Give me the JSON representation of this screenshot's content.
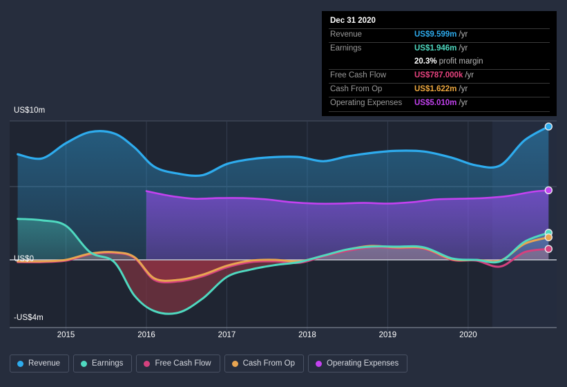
{
  "chart_data": {
    "type": "area",
    "title": "",
    "xlabel": "",
    "ylabel": "",
    "grid": true,
    "legend_position": "bottom",
    "x_ticks": [
      "2015",
      "2016",
      "2017",
      "2018",
      "2019",
      "2020"
    ],
    "y_ticks": [
      "US$10m",
      "US$0",
      "-US$4m"
    ],
    "ylim": [
      -4,
      10
    ],
    "xlim": [
      2014.3,
      2021.1
    ],
    "gridlines_y": [
      10,
      5,
      0
    ],
    "colors": {
      "revenue": "#2eacee",
      "earnings": "#4fd9c0",
      "free_cash_flow": "#d4417e",
      "cash_from_op": "#e8a551",
      "operating_expenses": "#c342f0",
      "background": "#262d3d",
      "plot_background": "#1f2532",
      "axis_line": "#9aa1ae",
      "gridline": "#3d4556",
      "tooltip_background": "#000000"
    },
    "series": [
      {
        "name": "Revenue",
        "color": "#2eacee",
        "x": [
          2014.4,
          2014.7,
          2015.0,
          2015.3,
          2015.6,
          2015.85,
          2016.1,
          2016.4,
          2016.7,
          2017.0,
          2017.3,
          2017.6,
          2017.9,
          2018.2,
          2018.5,
          2018.8,
          2019.1,
          2019.45,
          2019.8,
          2020.1,
          2020.4,
          2020.7,
          2021.0
        ],
        "values": [
          7.6,
          7.3,
          8.4,
          9.2,
          9.1,
          8.1,
          6.7,
          6.2,
          6.1,
          6.9,
          7.25,
          7.4,
          7.4,
          7.1,
          7.45,
          7.7,
          7.85,
          7.8,
          7.35,
          6.8,
          6.8,
          8.6,
          9.599
        ]
      },
      {
        "name": "Earnings",
        "color": "#4fd9c0",
        "x": [
          2014.4,
          2014.7,
          2015.0,
          2015.3,
          2015.6,
          2015.85,
          2016.1,
          2016.4,
          2016.7,
          2017.0,
          2017.3,
          2017.6,
          2017.9,
          2018.2,
          2018.5,
          2018.8,
          2019.1,
          2019.45,
          2019.8,
          2020.1,
          2020.4,
          2020.7,
          2021.0
        ],
        "values": [
          2.95,
          2.85,
          2.45,
          0.55,
          -0.15,
          -2.4,
          -3.45,
          -3.55,
          -2.6,
          -1.15,
          -0.65,
          -0.35,
          -0.15,
          0.3,
          0.75,
          0.95,
          0.95,
          0.9,
          0.1,
          0.0,
          -0.1,
          1.3,
          1.946
        ]
      },
      {
        "name": "Free Cash Flow",
        "color": "#d4417e",
        "x": [
          2014.4,
          2014.7,
          2015.0,
          2015.3,
          2015.6,
          2015.85,
          2016.1,
          2016.4,
          2016.7,
          2017.0,
          2017.3,
          2017.6,
          2017.9,
          2018.2,
          2018.5,
          2018.8,
          2019.1,
          2019.45,
          2019.8,
          2020.1,
          2020.4,
          2020.7,
          2021.0
        ],
        "values": [
          -0.15,
          -0.15,
          -0.05,
          0.4,
          0.5,
          0.15,
          -1.35,
          -1.45,
          -1.1,
          -0.5,
          -0.15,
          -0.1,
          -0.2,
          0.25,
          0.65,
          0.9,
          0.85,
          0.8,
          0.0,
          -0.05,
          -0.45,
          0.55,
          0.787
        ]
      },
      {
        "name": "Cash From Op",
        "color": "#e8a551",
        "x": [
          2014.4,
          2014.7,
          2015.0,
          2015.3,
          2015.6,
          2015.85,
          2016.1,
          2016.4,
          2016.7,
          2017.0,
          2017.3,
          2017.6,
          2017.9,
          2018.2,
          2018.5,
          2018.8,
          2019.1,
          2019.45,
          2019.8,
          2020.1,
          2020.4,
          2020.7,
          2021.0
        ],
        "values": [
          -0.1,
          -0.1,
          0.0,
          0.45,
          0.55,
          0.2,
          -1.25,
          -1.35,
          -1.0,
          -0.4,
          -0.05,
          0.0,
          -0.1,
          0.3,
          0.75,
          1.0,
          0.9,
          0.85,
          0.05,
          0.0,
          -0.05,
          1.15,
          1.622
        ]
      },
      {
        "name": "Operating Expenses",
        "color": "#c342f0",
        "x": [
          2016.0,
          2016.3,
          2016.6,
          2016.9,
          2017.2,
          2017.5,
          2017.8,
          2018.1,
          2018.4,
          2018.7,
          2019.0,
          2019.3,
          2019.6,
          2019.9,
          2020.2,
          2020.5,
          2020.8,
          2021.0
        ],
        "values": [
          4.95,
          4.6,
          4.4,
          4.45,
          4.45,
          4.35,
          4.15,
          4.05,
          4.05,
          4.1,
          4.05,
          4.15,
          4.35,
          4.4,
          4.45,
          4.6,
          4.9,
          5.01
        ]
      }
    ],
    "highlight_band": {
      "from": 2020.3,
      "to": 2021.1
    },
    "end_markers": [
      {
        "series": "Revenue",
        "value": 9.599
      },
      {
        "series": "Operating Expenses",
        "value": 5.01
      },
      {
        "series": "Earnings",
        "value": 1.946
      },
      {
        "series": "Cash From Op",
        "value": 1.622
      },
      {
        "series": "Free Cash Flow",
        "value": 0.787
      }
    ]
  },
  "tooltip": {
    "title": "Dec 31 2020",
    "rows": [
      {
        "label": "Revenue",
        "value": "US$9.599m",
        "unit": "/yr",
        "color": "#2eacee"
      },
      {
        "label": "Earnings",
        "value": "US$1.946m",
        "unit": "/yr",
        "color": "#4fd9c0"
      },
      {
        "label": "",
        "value": "20.3%",
        "unit": "profit margin",
        "color": "#ffffff"
      },
      {
        "label": "Free Cash Flow",
        "value": "US$787.000k",
        "unit": "/yr",
        "color": "#e8437f"
      },
      {
        "label": "Cash From Op",
        "value": "US$1.622m",
        "unit": "/yr",
        "color": "#eda83f"
      },
      {
        "label": "Operating Expenses",
        "value": "US$5.010m",
        "unit": "/yr",
        "color": "#c342f0"
      }
    ]
  },
  "legend": {
    "items": [
      {
        "label": "Revenue",
        "color": "#2eacee"
      },
      {
        "label": "Earnings",
        "color": "#4fd9c0"
      },
      {
        "label": "Free Cash Flow",
        "color": "#d4417e"
      },
      {
        "label": "Cash From Op",
        "color": "#e8a551"
      },
      {
        "label": "Operating Expenses",
        "color": "#c342f0"
      }
    ]
  }
}
